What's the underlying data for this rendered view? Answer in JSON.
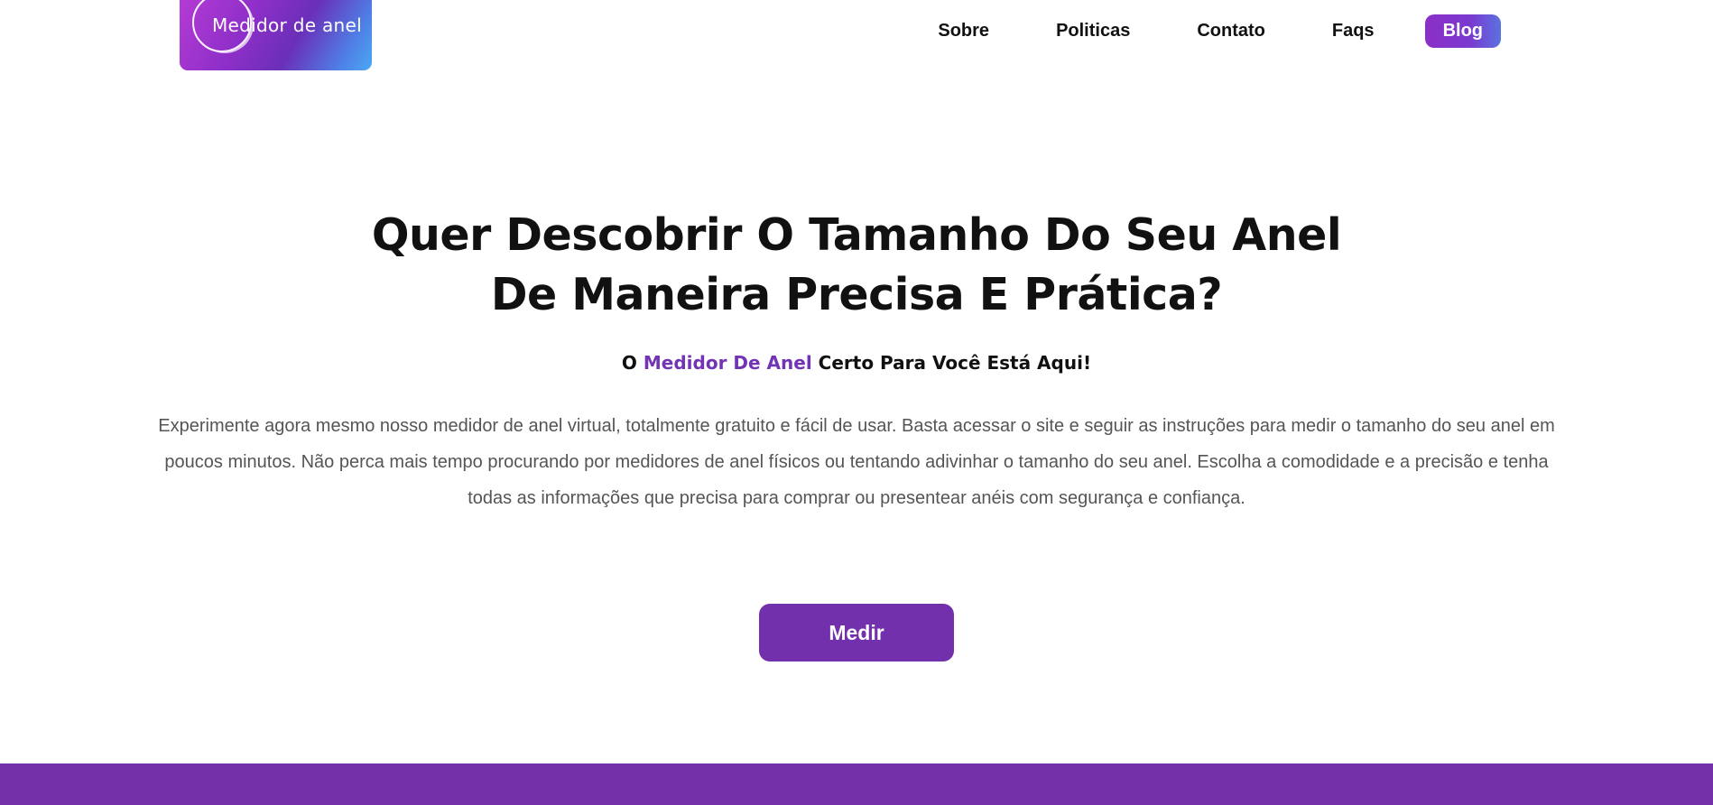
{
  "header": {
    "logo_text": "Medidor de anel",
    "nav": [
      {
        "label": "Sobre"
      },
      {
        "label": "Politicas"
      },
      {
        "label": "Contato"
      },
      {
        "label": "Faqs"
      },
      {
        "label": "Blog"
      }
    ]
  },
  "hero": {
    "title_line1": "Quer Descobrir O Tamanho Do Seu Anel",
    "title_line2": "De Maneira Precisa E Prática?",
    "subtitle_prefix": "O ",
    "subtitle_accent": "Medidor De Anel",
    "subtitle_suffix": " Certo Para Você Está Aqui!",
    "body": "Experimente agora mesmo nosso medidor de anel virtual, totalmente gratuito e fácil de usar. Basta acessar o site e seguir as instruções para medir o tamanho do seu anel em poucos minutos. Não perca mais tempo procurando por medidores de anel físicos ou tentando adivinhar o tamanho do seu anel. Escolha a comodidade e a precisão e tenha todas as informações que precisa para comprar ou presentear anéis com segurança e confiança.",
    "cta_label": "Medir"
  },
  "colors": {
    "accent": "#7330ad",
    "text": "#111111",
    "body_text": "#555555"
  }
}
